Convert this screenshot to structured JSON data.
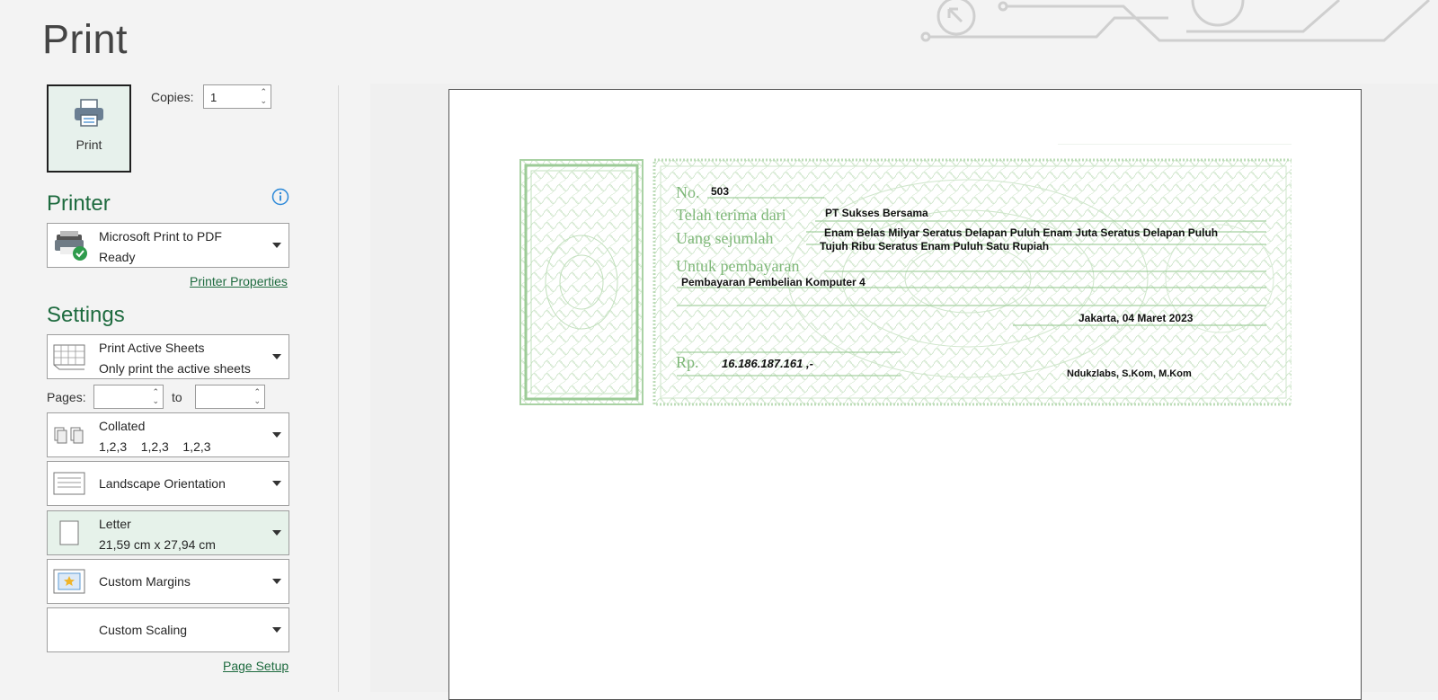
{
  "page_title": "Print",
  "print_button": {
    "label": "Print"
  },
  "copies": {
    "label": "Copies:",
    "value": "1"
  },
  "printer": {
    "heading": "Printer",
    "name": "Microsoft Print to PDF",
    "status": "Ready",
    "properties_link": "Printer Properties"
  },
  "settings": {
    "heading": "Settings",
    "what_to_print": {
      "title": "Print Active Sheets",
      "subtitle": "Only print the active sheets"
    },
    "pages": {
      "label": "Pages:",
      "to_label": "to",
      "from_value": "",
      "to_value": ""
    },
    "collation": {
      "title": "Collated",
      "subtitle": "1,2,3    1,2,3    1,2,3"
    },
    "orientation": {
      "title": "Landscape Orientation"
    },
    "paper": {
      "title": "Letter",
      "subtitle": "21,59 cm x 27,94 cm"
    },
    "margins": {
      "title": "Custom Margins"
    },
    "scaling": {
      "title": "Custom Scaling"
    },
    "page_setup_link": "Page Setup"
  },
  "preview": {
    "receipt": {
      "no_label": "No.",
      "no_value": "503",
      "from_label": "Telah terima dari",
      "from_value": "PT Sukses Bersama",
      "amount_label": "Uang sejumlah",
      "amount_words_1": "Enam Belas Milyar Seratus Delapan Puluh Enam Juta Seratus Delapan Puluh",
      "amount_words_2": "Tujuh Ribu Seratus Enam Puluh Satu Rupiah",
      "purpose_label": "Untuk pembayaran",
      "purpose_value": "Pembayaran Pembelian Komputer 4",
      "place_date": "Jakarta, 04 Maret 2023",
      "rp_label": "Rp.",
      "amount_number": "16.186.187.161 ,-",
      "signer": "Ndukzlabs, S.Kom, M.Kom"
    }
  },
  "colors": {
    "accent": "#1e6b3f",
    "cheque_green": "#8fc58a"
  }
}
